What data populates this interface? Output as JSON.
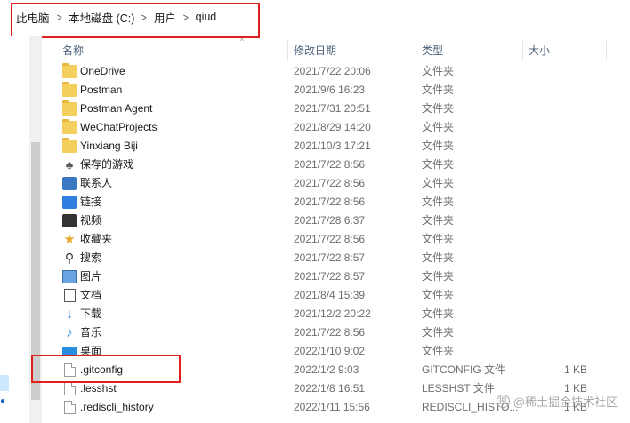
{
  "breadcrumb": [
    "此电脑",
    "本地磁盘 (C:)",
    "用户",
    "qiud"
  ],
  "columns": {
    "name": "名称",
    "date": "修改日期",
    "type": "类型",
    "size": "大小"
  },
  "rows": [
    {
      "name": "OneDrive",
      "date": "2021/7/22 20:06",
      "type": "文件夹",
      "size": "",
      "icon": "folder-icon"
    },
    {
      "name": "Postman",
      "date": "2021/9/6 16:23",
      "type": "文件夹",
      "size": "",
      "icon": "folder-icon"
    },
    {
      "name": "Postman Agent",
      "date": "2021/7/31 20:51",
      "type": "文件夹",
      "size": "",
      "icon": "folder-icon"
    },
    {
      "name": "WeChatProjects",
      "date": "2021/8/29 14:20",
      "type": "文件夹",
      "size": "",
      "icon": "folder-icon"
    },
    {
      "name": "Yinxiang Biji",
      "date": "2021/10/3 17:21",
      "type": "文件夹",
      "size": "",
      "icon": "folder-icon"
    },
    {
      "name": "保存的游戏",
      "date": "2021/7/22 8:56",
      "type": "文件夹",
      "size": "",
      "icon": "saved-games-icon"
    },
    {
      "name": "联系人",
      "date": "2021/7/22 8:56",
      "type": "文件夹",
      "size": "",
      "icon": "contacts-icon"
    },
    {
      "name": "链接",
      "date": "2021/7/22 8:56",
      "type": "文件夹",
      "size": "",
      "icon": "links-icon"
    },
    {
      "name": "视频",
      "date": "2021/7/28 6:37",
      "type": "文件夹",
      "size": "",
      "icon": "videos-icon"
    },
    {
      "name": "收藏夹",
      "date": "2021/7/22 8:56",
      "type": "文件夹",
      "size": "",
      "icon": "favorites-icon"
    },
    {
      "name": "搜索",
      "date": "2021/7/22 8:57",
      "type": "文件夹",
      "size": "",
      "icon": "searches-icon"
    },
    {
      "name": "图片",
      "date": "2021/7/22 8:57",
      "type": "文件夹",
      "size": "",
      "icon": "pictures-icon"
    },
    {
      "name": "文档",
      "date": "2021/8/4 15:39",
      "type": "文件夹",
      "size": "",
      "icon": "documents-icon"
    },
    {
      "name": "下载",
      "date": "2021/12/2 20:22",
      "type": "文件夹",
      "size": "",
      "icon": "downloads-icon"
    },
    {
      "name": "音乐",
      "date": "2021/7/22 8:56",
      "type": "文件夹",
      "size": "",
      "icon": "music-icon"
    },
    {
      "name": "桌面",
      "date": "2022/1/10 9:02",
      "type": "文件夹",
      "size": "",
      "icon": "desktop-icon"
    },
    {
      "name": ".gitconfig",
      "date": "2022/1/2 9:03",
      "type": "GITCONFIG 文件",
      "size": "1 KB",
      "icon": "file-icon"
    },
    {
      "name": ".lesshst",
      "date": "2022/1/8 16:51",
      "type": "LESSHST 文件",
      "size": "1 KB",
      "icon": "file-icon"
    },
    {
      "name": ".rediscli_history",
      "date": "2022/1/11 15:56",
      "type": "REDISCLI_HISTO...",
      "size": "1 KB",
      "icon": "file-icon"
    }
  ],
  "watermark": "@稀土掘金技术社区",
  "colors": {
    "highlight_box": "#e0201f",
    "folder": "#f4cf5e",
    "header_text": "#4c607a"
  }
}
